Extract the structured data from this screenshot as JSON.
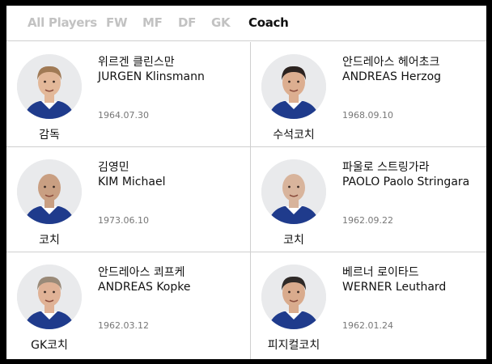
{
  "tabs": [
    {
      "label": "All Players",
      "active": false
    },
    {
      "label": "FW",
      "active": false
    },
    {
      "label": "MF",
      "active": false
    },
    {
      "label": "DF",
      "active": false
    },
    {
      "label": "GK",
      "active": false
    },
    {
      "label": "Coach",
      "active": true
    }
  ],
  "coaches": [
    {
      "name_ko": "위르겐 클린스만",
      "name_en": "JURGEN Klinsmann",
      "birth": "1964.07.30",
      "role": "감독",
      "hair": "#a07a55",
      "skin": "#e3b899"
    },
    {
      "name_ko": "안드레아스 헤어초크",
      "name_en": "ANDREAS Herzog",
      "birth": "1968.09.10",
      "role": "수석코치",
      "hair": "#2c2320",
      "skin": "#dcae90"
    },
    {
      "name_ko": "김영민",
      "name_en": "KIM Michael",
      "birth": "1973.06.10",
      "role": "코치",
      "hair": "#c99f82",
      "skin": "#c99f82"
    },
    {
      "name_ko": "파울로 스트링가라",
      "name_en": "PAOLO Paolo Stringara",
      "birth": "1962.09.22",
      "role": "코치",
      "hair": "#d8b49c",
      "skin": "#d8b49c"
    },
    {
      "name_ko": "안드레아스 쾨프케",
      "name_en": "ANDREAS Kopke",
      "birth": "1962.03.12",
      "role": "GK코치",
      "hair": "#9a8a78",
      "skin": "#e0b296"
    },
    {
      "name_ko": "베르너 로이타드",
      "name_en": "WERNER Leuthard",
      "birth": "1962.01.24",
      "role": "피지컬코치",
      "hair": "#2f2a28",
      "skin": "#d9ab8d"
    }
  ],
  "colors": {
    "jersey": "#1f3b8c",
    "jersey_trim": "#ffffff",
    "avatar_bg": "#e9eaec",
    "active_tab": "#111111",
    "inactive_tab": "#c2c2c2"
  }
}
